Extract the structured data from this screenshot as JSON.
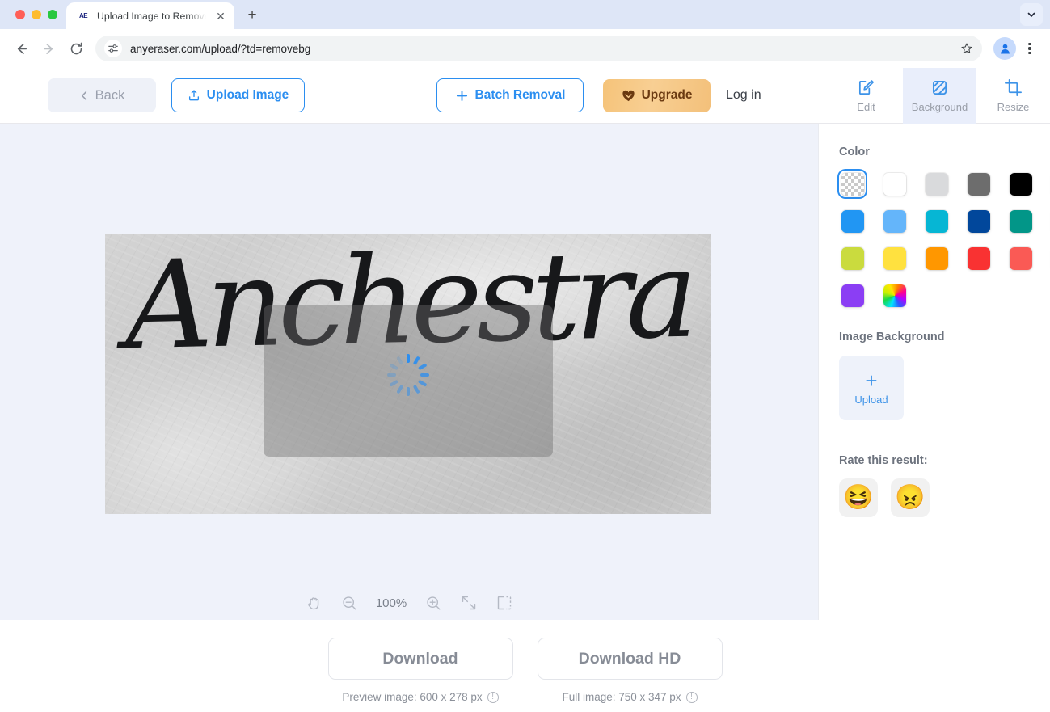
{
  "browser": {
    "tab": {
      "title": "Upload Image to Remove Bg |",
      "favicon_text": "AE",
      "close_label": "✕"
    },
    "new_tab_label": "+",
    "tab_search_icon": "chevron-down-icon",
    "nav": {
      "back": "back-arrow-icon",
      "forward": "forward-arrow-icon",
      "reload": "reload-icon"
    },
    "url": "anyeraser.com/upload/?td=removebg",
    "omnibox_icon": "site-settings-icon",
    "star_icon": "bookmark-star-icon",
    "profile_icon": "profile-avatar-icon",
    "menu_icon": "three-dot-menu-icon"
  },
  "toolbar": {
    "back_label": "Back",
    "upload_label": "Upload Image",
    "batch_label": "Batch Removal",
    "upgrade_label": "Upgrade",
    "login_label": "Log in",
    "tabs": [
      {
        "label": "Edit",
        "icon": "edit-pencil-icon",
        "active": false
      },
      {
        "label": "Background",
        "icon": "background-hatch-icon",
        "active": true
      },
      {
        "label": "Resize",
        "icon": "crop-resize-icon",
        "active": false
      }
    ]
  },
  "canvas": {
    "artwork_text": "Anchestra",
    "spinner_color": "#2b8ef0",
    "zoom": {
      "level": "100%",
      "tools": [
        {
          "name": "hand-pan-icon"
        },
        {
          "name": "zoom-out-icon"
        },
        {
          "name": "zoom-in-icon"
        },
        {
          "name": "fit-screen-icon"
        },
        {
          "name": "compare-split-icon"
        }
      ]
    }
  },
  "sidebar": {
    "color_heading": "Color",
    "swatches": [
      {
        "name": "transparent",
        "hex": "transparent",
        "selected": true
      },
      {
        "name": "white",
        "hex": "#ffffff",
        "selected": false
      },
      {
        "name": "light-gray",
        "hex": "#d9dadc",
        "selected": false
      },
      {
        "name": "dark-gray",
        "hex": "#6d6d6d",
        "selected": false
      },
      {
        "name": "black",
        "hex": "#000000",
        "selected": false
      },
      {
        "name": "royal-blue",
        "hex": "#5b87f7",
        "selected": false
      },
      {
        "name": "azure-blue",
        "hex": "#2196f3",
        "selected": false
      },
      {
        "name": "sky-blue",
        "hex": "#64b5fa",
        "selected": false
      },
      {
        "name": "cyan",
        "hex": "#06b6d4",
        "selected": false
      },
      {
        "name": "navy-blue",
        "hex": "#01479b",
        "selected": false
      },
      {
        "name": "teal",
        "hex": "#029688",
        "selected": false
      },
      {
        "name": "green",
        "hex": "#4caf52",
        "selected": false
      },
      {
        "name": "lime",
        "hex": "#cadb3e",
        "selected": false
      },
      {
        "name": "yellow",
        "hex": "#ffe13f",
        "selected": false
      },
      {
        "name": "orange",
        "hex": "#ff9700",
        "selected": false
      },
      {
        "name": "red",
        "hex": "#f93232",
        "selected": false
      },
      {
        "name": "coral-red",
        "hex": "#fa5a55",
        "selected": false
      },
      {
        "name": "pink",
        "hex": "#f492ae",
        "selected": false
      },
      {
        "name": "purple",
        "hex": "#8b3ef4",
        "selected": false
      },
      {
        "name": "rainbow-picker",
        "hex": "rainbow",
        "selected": false
      }
    ],
    "image_background_heading": "Image Background",
    "upload_plus": "+",
    "upload_label": "Upload",
    "rate_heading": "Rate this result:",
    "rate_options": [
      {
        "name": "rate-happy-button",
        "emoji": "😆"
      },
      {
        "name": "rate-angry-button",
        "emoji": "😠"
      }
    ]
  },
  "download": {
    "preview": {
      "button_label": "Download",
      "meta": "Preview image: 600 x 278 px"
    },
    "full": {
      "button_label": "Download HD",
      "meta": "Full image: 750 x 347 px"
    }
  }
}
